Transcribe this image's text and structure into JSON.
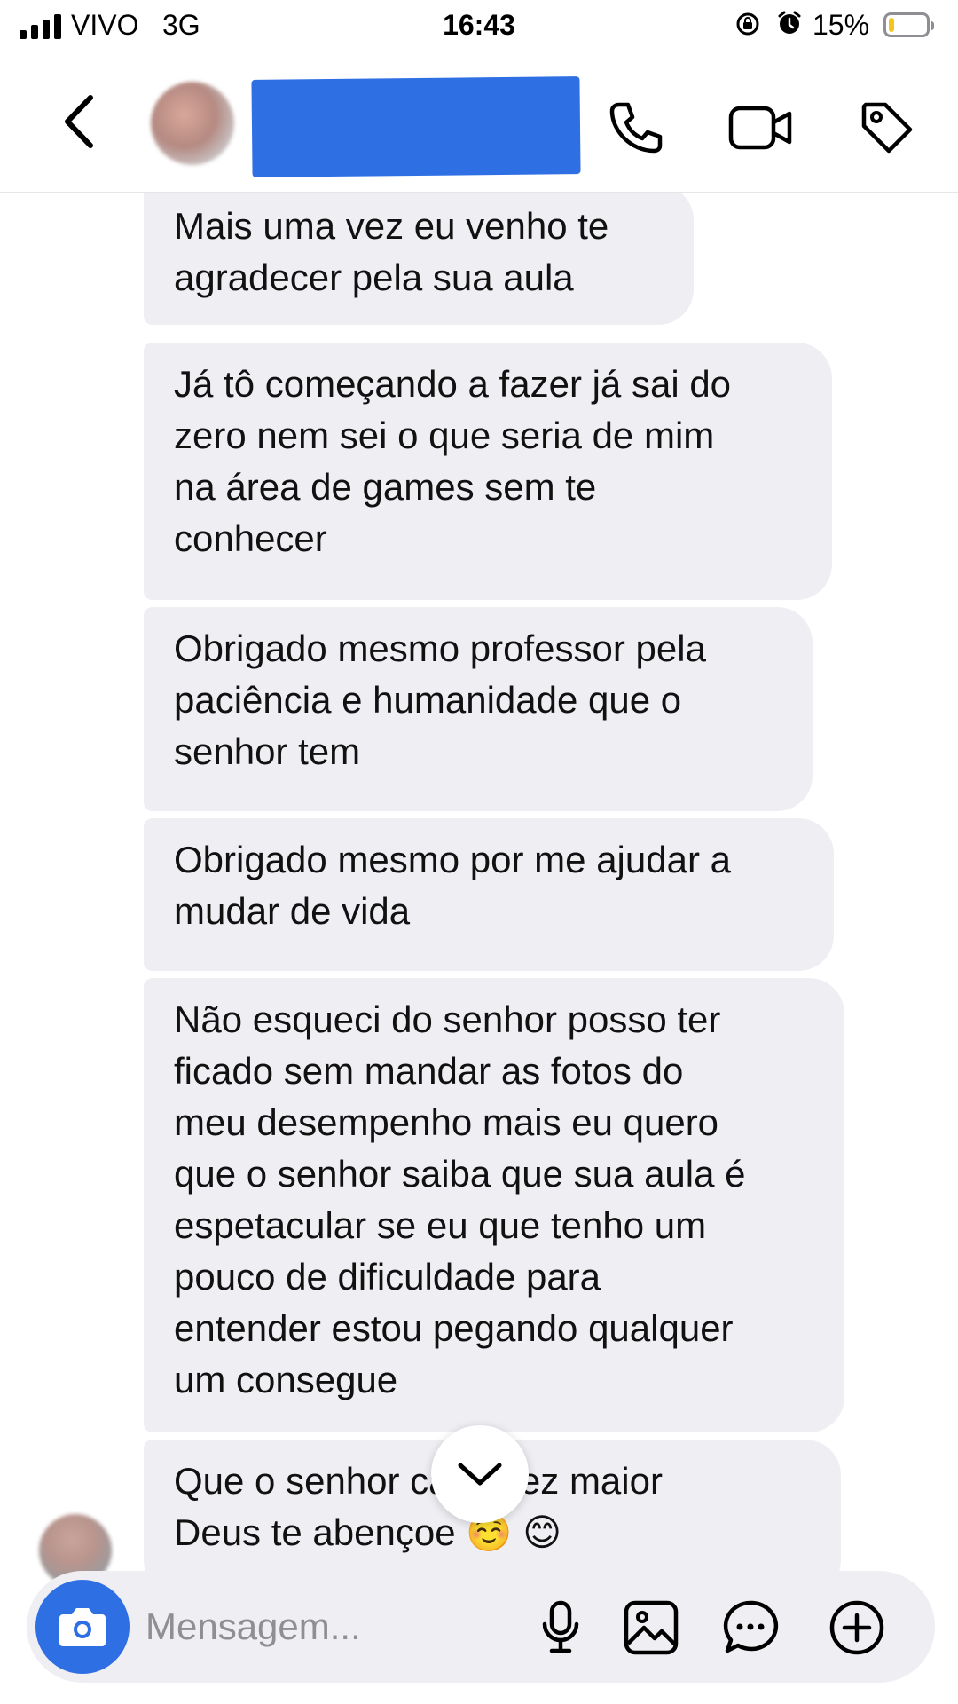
{
  "status_bar": {
    "carrier": "VIVO",
    "network": "3G",
    "time": "16:43",
    "battery_percent": "15%",
    "battery_level": 0.15,
    "battery_color": "#f5c518"
  },
  "header": {
    "back_icon": "chevron-left-icon",
    "contact_name": "",
    "icons": [
      "phone-icon",
      "video-camera-icon",
      "tag-icon"
    ]
  },
  "messages": [
    {
      "text": "Mais uma vez eu venho te\nagradecer pela sua aula"
    },
    {
      "text": "Já tô começando a fazer já sai do\nzero nem sei o que seria de mim\nna área de games sem te\nconhecer"
    },
    {
      "text": "Obrigado mesmo professor pela\npaciência e humanidade que o\nsenhor tem"
    },
    {
      "text": "Obrigado mesmo por me ajudar a\nmudar de vida"
    },
    {
      "text": "Não esqueci do senhor posso ter\nficado sem mandar as fotos do\nmeu desempenho mais eu quero\nque o senhor saiba que sua aula é\nespetacular se eu que tenho um\npouco de dificuldade para\nentender estou pegando qualquer\num consegue"
    },
    {
      "text": "Que o senhor         cada vez maior\nDeus te abençoe ☺️ 😊"
    }
  ],
  "composer": {
    "placeholder": "Mensagem...",
    "icons": [
      "camera-icon",
      "microphone-icon",
      "image-icon",
      "sticker-icon",
      "plus-circle-icon"
    ]
  },
  "colors": {
    "accent": "#2f6fe4",
    "bubble": "#efeef2",
    "placeholder": "#8e8e93"
  }
}
